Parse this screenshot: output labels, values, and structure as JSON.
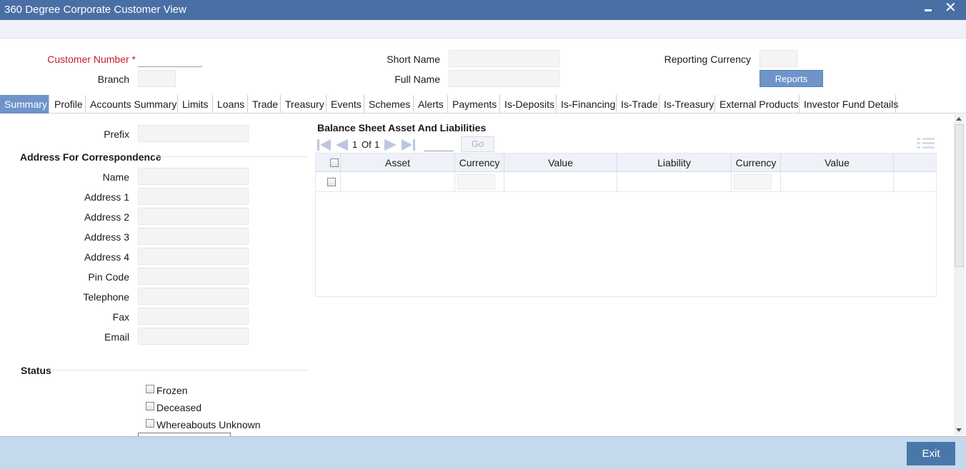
{
  "window": {
    "title": "360 Degree Corporate Customer View"
  },
  "header": {
    "customer_number_label": "Customer Number",
    "required_mark": "*",
    "branch_label": "Branch",
    "short_name_label": "Short Name",
    "full_name_label": "Full Name",
    "reporting_currency_label": "Reporting Currency",
    "reports_button": "Reports"
  },
  "tabs": [
    {
      "label": "Summary",
      "active": true
    },
    {
      "label": "Profile"
    },
    {
      "label": "Accounts Summary"
    },
    {
      "label": "Limits"
    },
    {
      "label": "Loans"
    },
    {
      "label": "Trade"
    },
    {
      "label": "Treasury"
    },
    {
      "label": "Events"
    },
    {
      "label": "Schemes"
    },
    {
      "label": "Alerts"
    },
    {
      "label": "Payments"
    },
    {
      "label": "Is-Deposits"
    },
    {
      "label": "Is-Financing"
    },
    {
      "label": "Is-Trade"
    },
    {
      "label": "Is-Treasury"
    },
    {
      "label": "External Products"
    },
    {
      "label": "Investor Fund Details"
    }
  ],
  "summary": {
    "prefix_label": "Prefix",
    "address_section": "Address For Correspondence",
    "address_fields": [
      "Name",
      "Address 1",
      "Address 2",
      "Address 3",
      "Address 4",
      "Pin Code",
      "Telephone",
      "Fax",
      "Email"
    ],
    "status_section": "Status",
    "status_checkboxes": [
      "Frozen",
      "Deceased",
      "Whereabouts Unknown"
    ]
  },
  "balance_sheet": {
    "title": "Balance Sheet Asset And Liabilities",
    "pager": {
      "current": "1",
      "of_label": "Of",
      "total": "1",
      "go_label": "Go"
    },
    "columns": [
      "Asset",
      "Currency",
      "Value",
      "Liability",
      "Currency",
      "Value"
    ]
  },
  "footer": {
    "exit_button": "Exit"
  },
  "colors": {
    "title_bar": "#4a6fa5",
    "active_tab": "#6e94c9",
    "footer": "#c5d9ec",
    "exit_button": "#4a77aa"
  }
}
